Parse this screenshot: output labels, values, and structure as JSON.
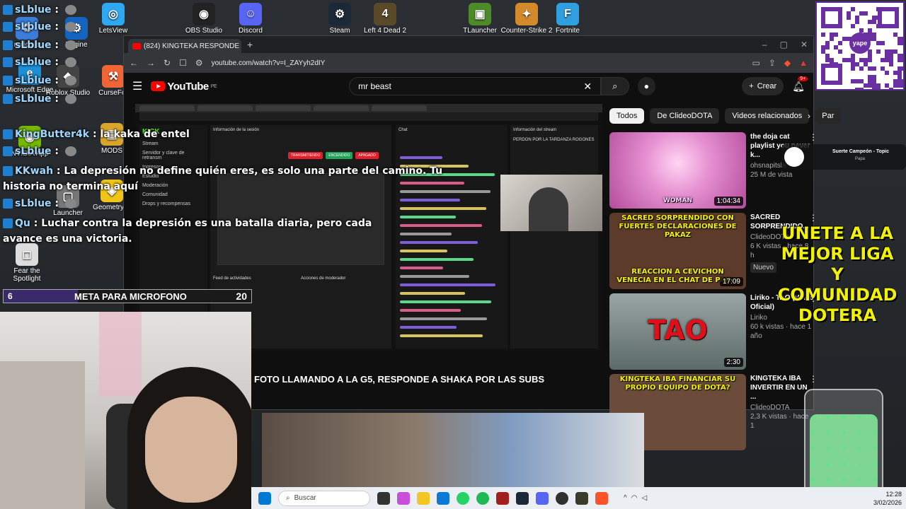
{
  "desktop": {
    "icons": [
      {
        "label": "Microsoft Edge",
        "color": "#1c8fd6",
        "glyph": "e"
      },
      {
        "label": "Roblox Studio",
        "color": "#444444",
        "glyph": "◆"
      },
      {
        "label": "CurseFor",
        "color": "#f16436",
        "glyph": "⚒"
      },
      {
        "label": "NVIDIA App",
        "color": "#76b900",
        "glyph": "◉"
      },
      {
        "label": "MODS",
        "color": "#d9a52b",
        "glyph": "▤"
      },
      {
        "label": "Launcher",
        "color": "#777777",
        "glyph": "▢"
      },
      {
        "label": "Geometry D",
        "color": "#f0c419",
        "glyph": "◈"
      },
      {
        "label": "Fear the Spotlight",
        "color": "#dddddd",
        "glyph": "◻"
      },
      {
        "label": "LetsView",
        "color": "#2ea8f0",
        "glyph": "◎"
      },
      {
        "label": "OBS Studio",
        "color": "#222222",
        "glyph": "◉"
      },
      {
        "label": "Discord",
        "color": "#5865f2",
        "glyph": "☺"
      },
      {
        "label": "Steam",
        "color": "#1b2838",
        "glyph": "⚙"
      },
      {
        "label": "Left 4 Dead 2",
        "color": "#5b4a2a",
        "glyph": "4"
      },
      {
        "label": "TLauncher",
        "color": "#4c8a2a",
        "glyph": "▣"
      },
      {
        "label": "Counter-Strike 2",
        "color": "#d28a2b",
        "glyph": "✦"
      },
      {
        "label": "Fortnite",
        "color": "#2f9fe0",
        "glyph": "F"
      },
      {
        "label": "reciclaje",
        "color": "#3b7dd8",
        "glyph": "♻"
      },
      {
        "label": "Engine",
        "color": "#1565c0",
        "glyph": "⚙"
      }
    ]
  },
  "chat": [
    {
      "user": "sLblue",
      "text": ""
    },
    {
      "user": "sLblue",
      "text": ""
    },
    {
      "user": "sLblue",
      "text": ""
    },
    {
      "user": "sLblue",
      "text": ""
    },
    {
      "user": "sLblue",
      "text": ""
    },
    {
      "user": "sLblue",
      "text": ""
    },
    {
      "user": "KingButter4k",
      "text": "la kaka de entel"
    },
    {
      "user": "sLblue",
      "text": ""
    },
    {
      "user": "KKwah",
      "text": "La depresión no define quién eres, es solo una parte del camino. Tu"
    },
    {
      "user": "",
      "text": "historia no termina aquí"
    },
    {
      "user": "sLblue",
      "text": ""
    },
    {
      "user": "Qu",
      "text": "Luchar contra la depresión es una batalla diaria, pero cada"
    },
    {
      "user": "",
      "text": "avance es una victoria."
    }
  ],
  "goal": {
    "label": "META PARA MICROFONO",
    "current": "6",
    "target": "20",
    "progress": 0.3
  },
  "browser": {
    "tab_title": "(824) KINGTEKA RESPONDE",
    "url": "youtube.com/watch?v=I_ZAYyh2dIY"
  },
  "youtube": {
    "logo": "YouTube",
    "logo_region": "PE",
    "search_value": "mr beast",
    "create_label": "Crear",
    "notif_count": "9+",
    "video_title": "FOTO LLAMANDO A LA G5, RESPONDE A SHAKA POR LAS SUBS",
    "chips": [
      "Todos",
      "De ClideoDOTA",
      "Videos relacionados",
      "Par"
    ],
    "recommendations": [
      {
        "title": "the doja cat playlist you never k...",
        "channel": "ohsnapitsla",
        "views": "25 M de vista",
        "duration": "1:04:34",
        "thumb_text": "WOMAN",
        "bg": "#e58fd0"
      },
      {
        "title": "SACRED SORPRENDIDO...",
        "channel": "ClideoDOTA",
        "views": "6 K vistas · hace 8 h",
        "duration": "17:09",
        "badge": "Nuevo",
        "thumb_text": "SACRED SORPRENDIDO CON FUERTES DECLARACIONES DE PAKAZ",
        "thumb_text2": "REACCION A CEVICHON VENECIA EN EL CHAT DE PAK...",
        "bg": "#5d3b2a"
      },
      {
        "title": "Liriko - TAO (Video Oficial)",
        "channel": "Liriko",
        "views": "60 k vistas · hace 1 año",
        "duration": "2:30",
        "thumb_text": "TAO",
        "bg": "#7f8a86"
      },
      {
        "title": "KINGTEKA IBA INVERTIR EN UN ...",
        "channel": "ClideoDOTA",
        "views": "2,3 K vistas · hace 1",
        "duration": "",
        "thumb_text": "KINGTEKA IBA FINANCIAR SU PROPIO EQUIPO DE DOTA?",
        "bg": "#6b4c3b"
      }
    ]
  },
  "inner_stream": {
    "kick_logo": "KICK",
    "side_items": [
      "Stream",
      "Servidor y clave de retransm",
      "Ingresos",
      "Estudio",
      "Moderación",
      "Comunidad",
      "Drops y recompensas"
    ],
    "info_title": "Información de la sesión",
    "chat_title": "Chat",
    "stream_info_title": "Información del stream",
    "stream_name": "PERDON POR LA TARDANZA ROGONES",
    "activity_title": "Feed de actividades",
    "mod_title": "Acciones de moderador",
    "status": [
      "TRANSMITIENDO",
      "ENCENDIDO",
      "APAGADO"
    ]
  },
  "promo": {
    "text": "UNETE A LA MEJOR LIGA Y COMUNIDAD DOTERA"
  },
  "music": {
    "title": "Suerte Campeón - Topic",
    "artist": "Papa"
  },
  "qr": {
    "brand": "yape"
  },
  "taskbar": {
    "search_placeholder": "Buscar",
    "time": "12:28",
    "date": "3/02/2026"
  }
}
